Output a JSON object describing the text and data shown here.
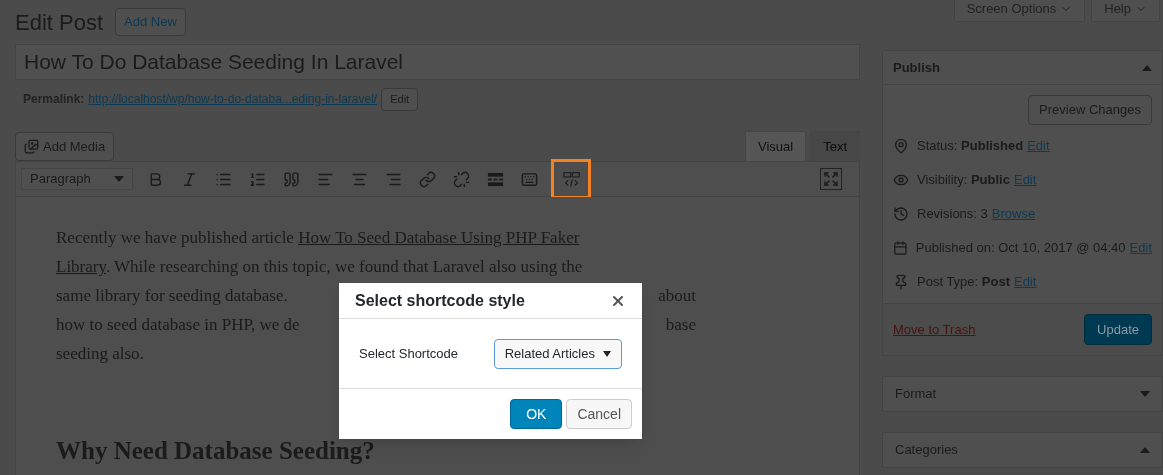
{
  "header": {
    "title": "Edit Post",
    "add_new": "Add New"
  },
  "screen_buttons": [
    {
      "label": "Screen Options"
    },
    {
      "label": "Help"
    }
  ],
  "post_title": "How To Do Database Seeding In Laravel",
  "permalink": {
    "label": "Permalink:",
    "url": "http://localhost/wp/how-to-do-databa...eding-in-laravel/",
    "edit": "Edit"
  },
  "add_media": "Add Media",
  "editor_tabs": [
    {
      "label": "Visual",
      "selected": true
    },
    {
      "label": "Text",
      "selected": false
    }
  ],
  "format_select": "Paragraph",
  "toolbar": [
    {
      "kind": "bold",
      "highlighted": false
    },
    {
      "kind": "italic",
      "highlighted": false
    },
    {
      "kind": "bullets",
      "highlighted": false
    },
    {
      "kind": "numbers",
      "highlighted": false
    },
    {
      "kind": "quote",
      "highlighted": false
    },
    {
      "kind": "align-left",
      "highlighted": false
    },
    {
      "kind": "align-center",
      "highlighted": false
    },
    {
      "kind": "align-right",
      "highlighted": false
    },
    {
      "kind": "link",
      "highlighted": false
    },
    {
      "kind": "unlink",
      "highlighted": false
    },
    {
      "kind": "more",
      "highlighted": false
    },
    {
      "kind": "keyboard",
      "highlighted": false
    },
    {
      "kind": "shortcode",
      "highlighted": true
    }
  ],
  "content": {
    "lines": [
      {
        "left": "Recently we have published article ",
        "link": "How To Seed Database Using PHP Faker"
      },
      {
        "link": "Library",
        "right": ". While researching on this topic, we found that Laravel also using the"
      },
      {
        "left": "same library for seeding database.",
        "right": "about"
      },
      {
        "left": "how to seed database in PHP, we de",
        "right": "base"
      },
      {
        "left": "seeding also."
      }
    ],
    "heading": "Why Need Database Seeding?"
  },
  "dialog": {
    "title": "Select shortcode style",
    "field_label": "Select Shortcode",
    "select_value": "Related Articles",
    "ok": "OK",
    "cancel": "Cancel"
  },
  "publish": {
    "title": "Publish",
    "expanded": true,
    "preview": "Preview Changes",
    "rows": [
      {
        "kind": "status",
        "text": "Status: **Published**",
        "link": "Edit"
      },
      {
        "kind": "visibility",
        "text": "Visibility: **Public**",
        "link": "Edit"
      },
      {
        "kind": "revisions",
        "text": "Revisions: 3",
        "link": "Browse"
      },
      {
        "kind": "date",
        "text": "Published on: Oct 10, 2017 @ 04:40",
        "link": "Edit"
      },
      {
        "kind": "type",
        "text": "Post Type: **Post**",
        "link": "Edit"
      }
    ],
    "trash": "Move to Trash",
    "update": "Update"
  },
  "boxes": [
    {
      "title": "Format",
      "expanded": false
    },
    {
      "title": "Categories",
      "expanded": true
    }
  ]
}
